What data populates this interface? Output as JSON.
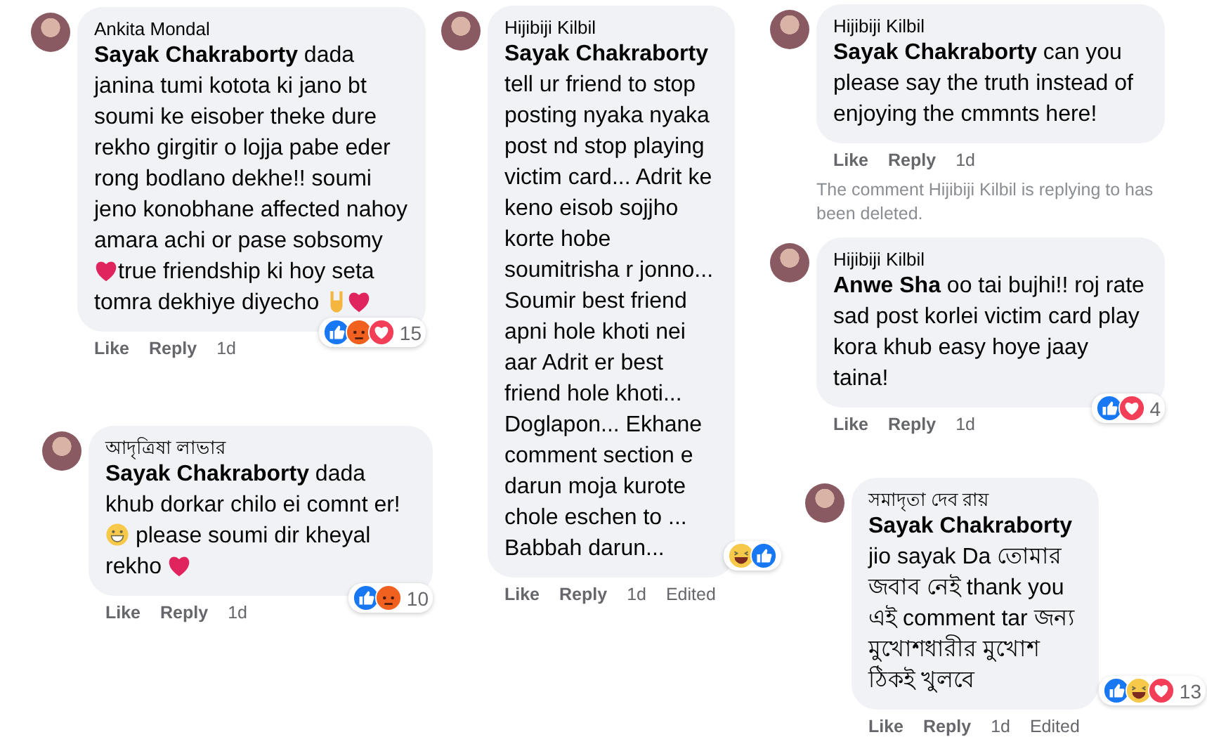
{
  "panels": [
    {
      "items": [
        {
          "kind": "comment",
          "author": "Ankita Mondal",
          "mention": "Sayak Chakraborty",
          "body": [
            {
              "kind": "text",
              "text": " dada janina tumi kotota ki jano bt soumi ke eisober theke dure rekho girgitir o lojja pabe eder rong bodlano dekhe!! soumi jeno konobhane affected nahoy amara achi or pase sobsomy "
            },
            {
              "kind": "heart"
            },
            {
              "kind": "text",
              "text": "true friendship ki hoy seta tomra dekhiye diyecho "
            },
            {
              "kind": "rock"
            },
            {
              "kind": "heart"
            }
          ],
          "actions": [
            "Like",
            "Reply"
          ],
          "time": "1d",
          "reactions": [
            {
              "kind": "like"
            },
            {
              "kind": "angry"
            },
            {
              "kind": "love"
            }
          ],
          "reaction_count": "15"
        }
      ]
    },
    {
      "items": [
        {
          "kind": "comment",
          "author": "আদৃত্রিষা লাভার",
          "mention": "Sayak Chakraborty",
          "body": [
            {
              "kind": "text",
              "text": " dada khub dorkar chilo ei comnt er!"
            },
            {
              "kind": "grin"
            },
            {
              "kind": "text",
              "text": " please soumi dir kheyal rekho "
            },
            {
              "kind": "heart"
            }
          ],
          "actions": [
            "Like",
            "Reply"
          ],
          "time": "1d",
          "reactions": [
            {
              "kind": "like"
            },
            {
              "kind": "angry"
            }
          ],
          "reaction_count": "10"
        }
      ]
    },
    {
      "items": [
        {
          "kind": "comment",
          "author": "Hijibiji Kilbil",
          "mention": "Sayak Chakraborty",
          "body": [
            {
              "kind": "text",
              "text": " tell ur friend to stop posting nyaka nyaka post nd stop playing victim card... Adrit ke keno eisob sojjho korte hobe soumitrisha r jonno... Soumir best friend apni hole khoti nei aar Adrit er best friend hole khoti... Doglapon... Ekhane comment section e darun moja kurote chole eschen to ... Babbah darun..."
            }
          ],
          "actions": [
            "Like",
            "Reply"
          ],
          "time": "1d",
          "edited": "Edited",
          "reactions": [
            {
              "kind": "haha"
            },
            {
              "kind": "like"
            }
          ]
        }
      ]
    },
    {
      "items": [
        {
          "kind": "comment",
          "author": "Hijibiji Kilbil",
          "mention": "Sayak Chakraborty",
          "body": [
            {
              "kind": "text",
              "text": " can you please say the truth instead of enjoying the cmmnts here!"
            }
          ],
          "actions": [
            "Like",
            "Reply"
          ],
          "time": "1d"
        },
        {
          "kind": "note",
          "text": "The comment Hijibiji Kilbil is replying to has been deleted."
        },
        {
          "kind": "comment",
          "author": "Hijibiji Kilbil",
          "mention": "Anwe Sha",
          "body": [
            {
              "kind": "text",
              "text": " oo tai bujhi!! roj rate sad post korlei victim card play kora khub easy hoye jaay taina!"
            }
          ],
          "actions": [
            "Like",
            "Reply"
          ],
          "time": "1d",
          "reactions": [
            {
              "kind": "like"
            },
            {
              "kind": "love"
            }
          ],
          "reaction_count": "4"
        }
      ]
    },
    {
      "items": [
        {
          "kind": "comment",
          "author": "সমাদৃতা দেব রায়",
          "mention": "Sayak Chakraborty",
          "body": [
            {
              "kind": "text",
              "text": " jio sayak Da তোমার জবাব নেই thank you এই comment tar জন্য মুখোশধারীর মুখোশ ঠিকই খুলবে"
            }
          ],
          "actions": [
            "Like",
            "Reply"
          ],
          "time": "1d",
          "edited": "Edited",
          "reactions": [
            {
              "kind": "like"
            },
            {
              "kind": "haha"
            },
            {
              "kind": "love"
            }
          ],
          "reaction_count": "13"
        }
      ]
    }
  ]
}
